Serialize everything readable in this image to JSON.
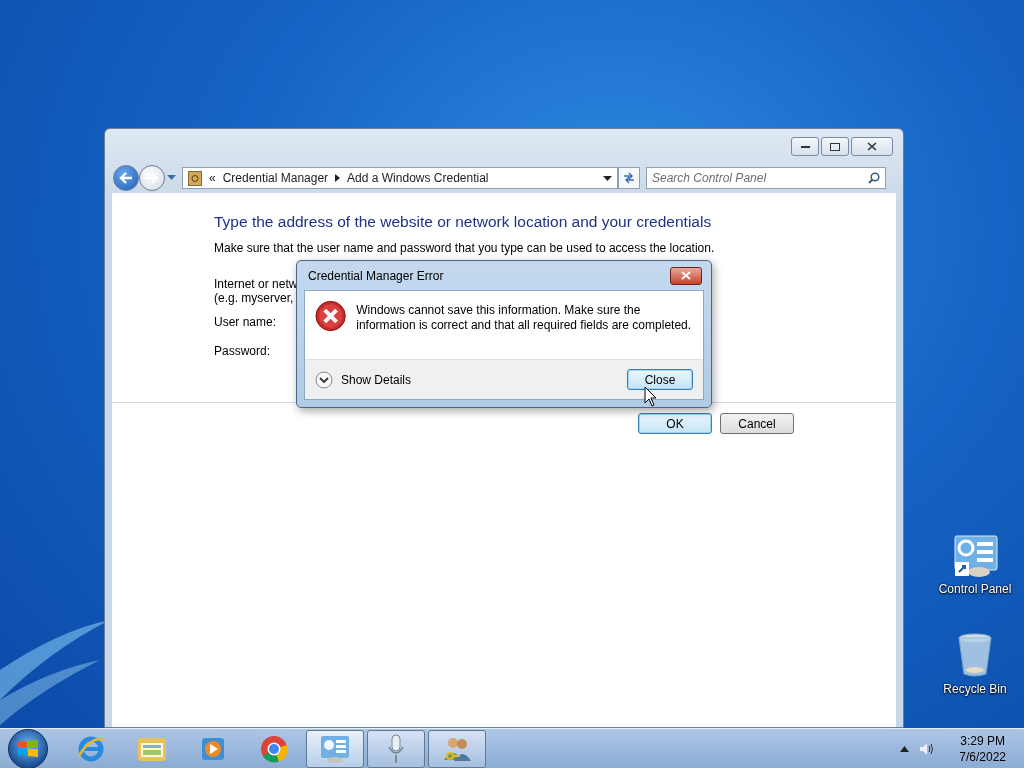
{
  "explorer": {
    "nav": {
      "overflow": "«",
      "crumbs": [
        "Credential Manager",
        "Add a Windows Credential"
      ]
    },
    "search": {
      "placeholder": "Search Control Panel"
    },
    "heading": "Type the address of the website or network location and your credentials",
    "instruction": "Make sure that the user name and password that you type can be used to access the location.",
    "labels": [
      "Internet or netw",
      "(e.g. myserver,",
      "User name:",
      "Password:"
    ],
    "buttons": [
      {
        "label": "OK",
        "default": true
      },
      {
        "label": "Cancel",
        "default": false
      }
    ]
  },
  "dialog": {
    "title": "Credential Manager Error",
    "message": "Windows cannot save this information. Make sure the information is correct and that all required fields are completed.",
    "details": {
      "label": "Show Details",
      "expanded": false
    },
    "button": "Close"
  },
  "desktop_icons": [
    {
      "kind": "control-panel",
      "label": "Control Panel"
    },
    {
      "kind": "recycle-bin",
      "label": "Recycle Bin"
    }
  ],
  "taskbar": {
    "items": [
      {
        "kind": "ie",
        "running": false,
        "selected": false
      },
      {
        "kind": "explorer",
        "running": false,
        "selected": false
      },
      {
        "kind": "media",
        "running": false,
        "selected": false
      },
      {
        "kind": "chrome",
        "running": false,
        "selected": false
      },
      {
        "kind": "control-panel",
        "running": true,
        "selected": true
      },
      {
        "kind": "mic",
        "running": true,
        "selected": false
      },
      {
        "kind": "users",
        "running": true,
        "selected": false
      }
    ],
    "time": "3:29 PM",
    "date": "7/6/2022"
  }
}
